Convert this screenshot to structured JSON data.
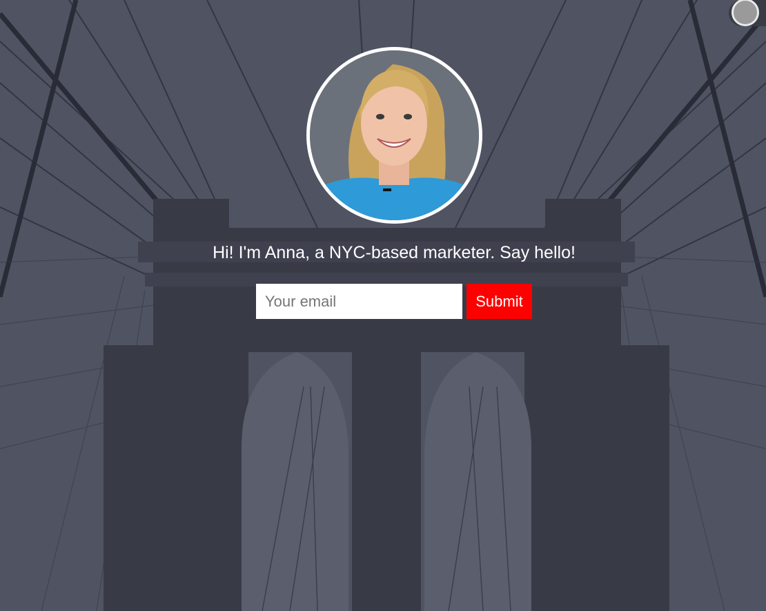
{
  "hero": {
    "greeting": "Hi! I'm Anna, a NYC-based marketer. Say hello!"
  },
  "form": {
    "email_placeholder": "Your email",
    "email_value": "",
    "submit_label": "Submit"
  },
  "colors": {
    "accent": "#ff0000",
    "text": "#ffffff",
    "background_tint": "#555866"
  },
  "icons": {
    "toggle": "toggle-switch-icon"
  }
}
